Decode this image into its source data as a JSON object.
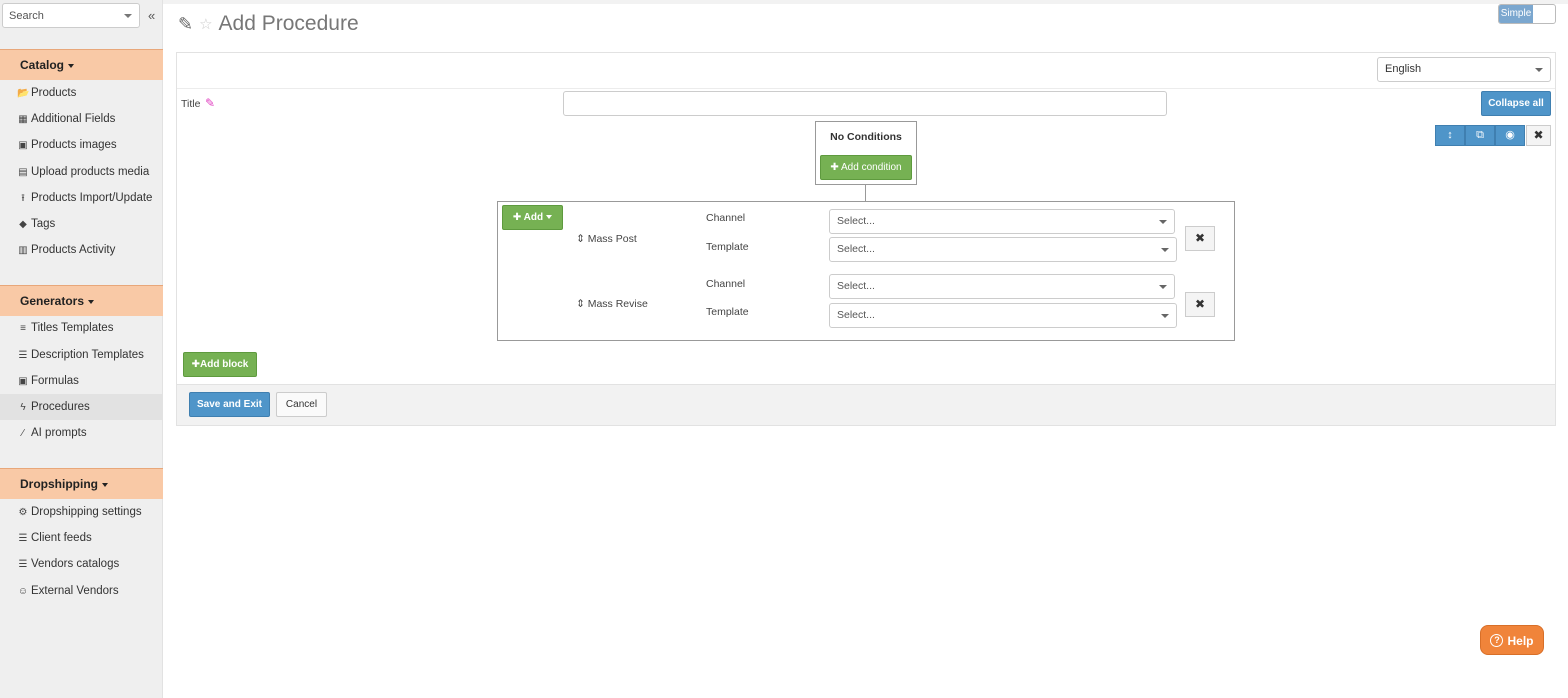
{
  "sidebar": {
    "search_placeholder": "Search",
    "collapse_glyph": "«",
    "sections": {
      "catalog": {
        "label": "Catalog",
        "items": [
          {
            "label": "Products",
            "icon": "folder-open-icon"
          },
          {
            "label": "Additional Fields",
            "icon": "grid-icon"
          },
          {
            "label": "Products images",
            "icon": "image-icon"
          },
          {
            "label": "Upload products media",
            "icon": "photo-upload-icon"
          },
          {
            "label": "Products Import/Update",
            "icon": "upload-icon"
          },
          {
            "label": "Tags",
            "icon": "tags-icon"
          },
          {
            "label": "Products Activity",
            "icon": "bar-chart-icon"
          }
        ]
      },
      "generators": {
        "label": "Generators",
        "items": [
          {
            "label": "Titles Templates",
            "icon": "text-height-icon"
          },
          {
            "label": "Description Templates",
            "icon": "list-lines-icon"
          },
          {
            "label": "Formulas",
            "icon": "money-icon"
          },
          {
            "label": "Procedures",
            "icon": "bolt-icon"
          },
          {
            "label": "AI prompts",
            "icon": "magic-wand-icon"
          }
        ]
      },
      "dropshipping": {
        "label": "Dropshipping",
        "items": [
          {
            "label": "Dropshipping settings",
            "icon": "cogs-icon"
          },
          {
            "label": "Client feeds",
            "icon": "list-icon"
          },
          {
            "label": "Vendors catalogs",
            "icon": "list-icon"
          },
          {
            "label": "External Vendors",
            "icon": "users-icon"
          }
        ]
      }
    }
  },
  "header": {
    "title": "Add Procedure",
    "mode_toggle_label": "Simple"
  },
  "form": {
    "language": "English",
    "title_label": "Title",
    "title_value": "",
    "collapse_all_label": "Collapse all",
    "conditions": {
      "title": "No Conditions",
      "add_condition_label": "Add condition"
    },
    "block": {
      "add_label": "Add",
      "actions": [
        {
          "name": "Mass Post",
          "channel_label": "Channel",
          "channel_value": "Select...",
          "template_label": "Template",
          "template_value": "Select..."
        },
        {
          "name": "Mass Revise",
          "channel_label": "Channel",
          "channel_value": "Select...",
          "template_label": "Template",
          "template_value": "Select..."
        }
      ]
    },
    "add_block_label": "Add block"
  },
  "footer": {
    "save_exit_label": "Save and Exit",
    "cancel_label": "Cancel"
  },
  "help": {
    "label": "Help"
  },
  "colors": {
    "section_bg": "#f9c9a6",
    "primary_blue": "#4f95c9",
    "success_green": "#76b153",
    "help_orange": "#f0843a"
  }
}
